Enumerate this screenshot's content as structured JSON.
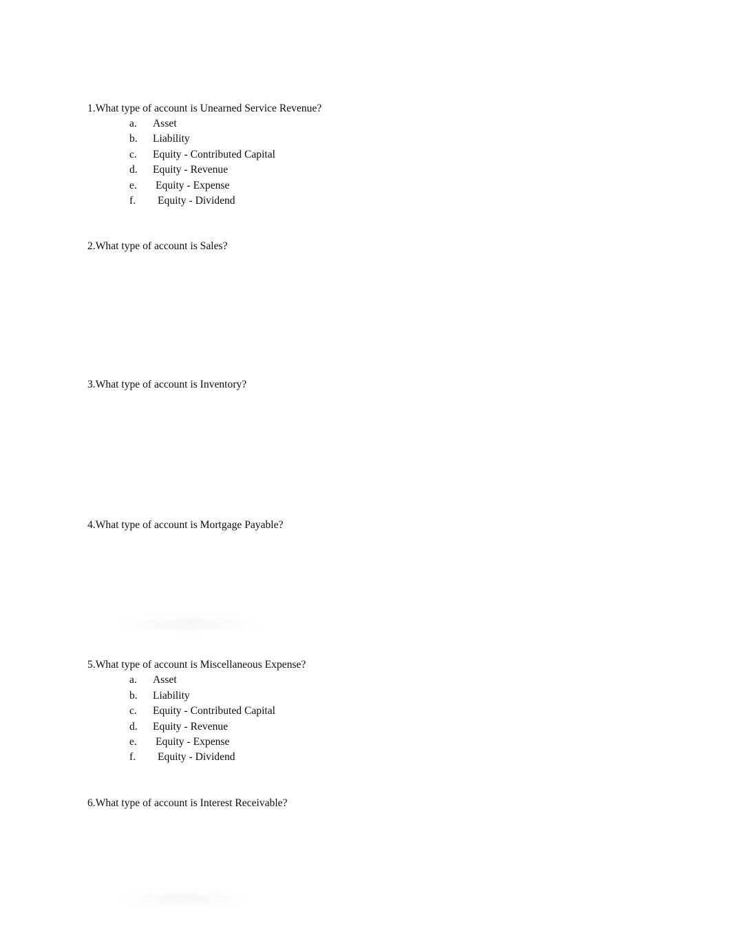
{
  "document": {
    "title": "Accounting Account Type Worksheet",
    "background_color": "#ffffff",
    "text_color": "#0d0d0d"
  },
  "questions": [
    {
      "number": "1.",
      "text": "What type of account is Unearned Service Revenue?",
      "full_line": "1.What type of account is Unearned Service Revenue?",
      "has_options": true,
      "options": [
        {
          "marker": "a.",
          "label": "Asset"
        },
        {
          "marker": "b.",
          "label": "Liability"
        },
        {
          "marker": "c.",
          "label": "Equity - Contributed Capital"
        },
        {
          "marker": "d.",
          "label": "Equity - Revenue"
        },
        {
          "marker": "e.",
          "label": "Equity - Expense"
        },
        {
          "marker": "f.",
          "label": "Equity - Dividend"
        }
      ]
    },
    {
      "number": "2.",
      "text": "What type of account is Sales?",
      "full_line": "2.What type of account is Sales?",
      "has_options": false,
      "options": []
    },
    {
      "number": "3.",
      "text": "What type of account is Inventory?",
      "full_line": "3.What type of account is Inventory?",
      "has_options": false,
      "options": []
    },
    {
      "number": "4.",
      "text": "What type of account is Mortgage Payable?",
      "full_line": "4.What type of account is Mortgage Payable?",
      "has_options": false,
      "options": []
    },
    {
      "number": "5.",
      "text": "What type of account is Miscellaneous Expense?",
      "full_line": "5.What type of account is Miscellaneous Expense?",
      "has_options": true,
      "options": [
        {
          "marker": "a.",
          "label": "Asset"
        },
        {
          "marker": "b.",
          "label": "Liability"
        },
        {
          "marker": "c.",
          "label": "Equity - Contributed Capital"
        },
        {
          "marker": "d.",
          "label": "Equity - Revenue"
        },
        {
          "marker": "e.",
          "label": "Equity - Expense"
        },
        {
          "marker": "f.",
          "label": "Equity - Dividend"
        }
      ]
    },
    {
      "number": "6.",
      "text": "What type of account is Interest Receivable?",
      "full_line": "6.What type of account is Interest Receivable?",
      "has_options": false,
      "options": []
    }
  ]
}
